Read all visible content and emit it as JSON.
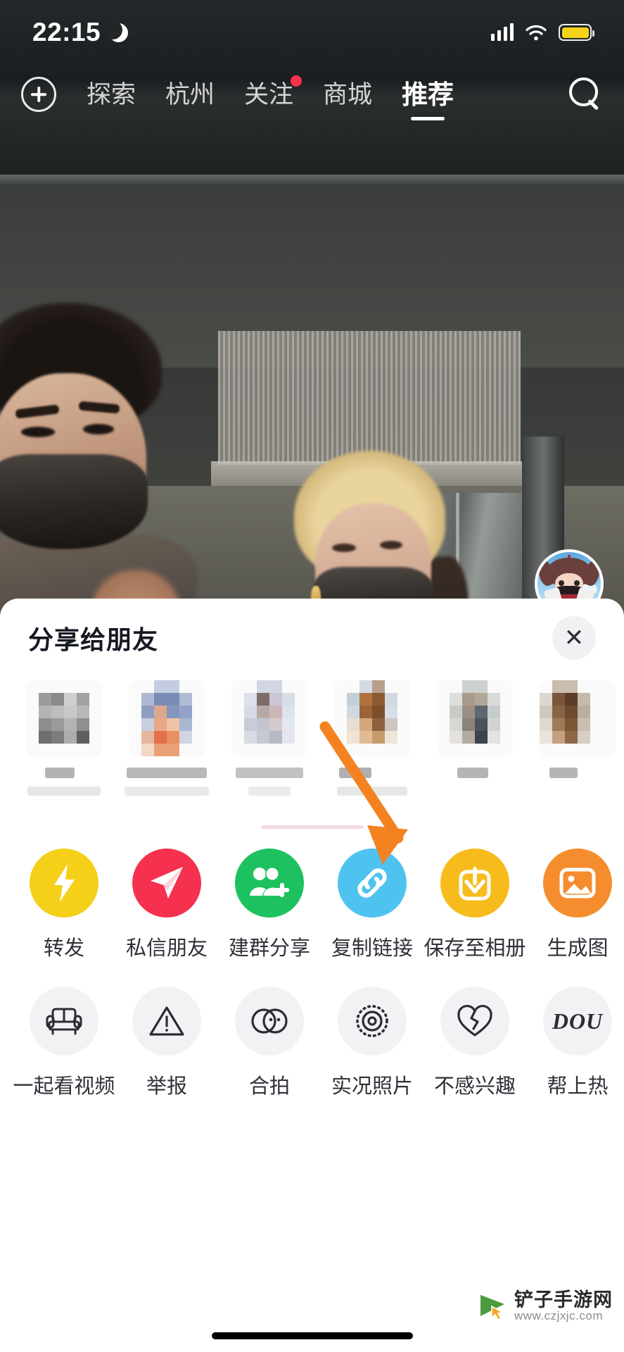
{
  "status_bar": {
    "time": "22:15",
    "moon_icon": "crescent-moon-icon",
    "signal_icon": "cellular-signal-icon",
    "wifi_icon": "wifi-icon",
    "battery_icon": "battery-icon",
    "battery_color": "#f5d318"
  },
  "top_nav": {
    "add_icon": "plus-circle-icon",
    "search_icon": "search-icon",
    "tabs": [
      {
        "label": "探索",
        "active": false,
        "badge": false
      },
      {
        "label": "杭州",
        "active": false,
        "badge": false
      },
      {
        "label": "关注",
        "active": false,
        "badge": true
      },
      {
        "label": "商城",
        "active": false,
        "badge": false
      },
      {
        "label": "推荐",
        "active": true,
        "badge": false
      }
    ],
    "badge_color": "#f6334e"
  },
  "right_rail": {
    "avatar_name": "avatar",
    "follow_label": "+",
    "follow_color": "#fa2c55",
    "like_icon": "heart-icon"
  },
  "share_sheet": {
    "title": "分享给朋友",
    "close_label": "✕",
    "friends": [
      {
        "name": "",
        "censored": true
      },
      {
        "name": "",
        "censored": true
      },
      {
        "name": "",
        "censored": true
      },
      {
        "name": "",
        "censored": true
      },
      {
        "name": "",
        "censored": true
      },
      {
        "name": "",
        "censored": true
      }
    ],
    "actions_row1": [
      {
        "label": "转发",
        "icon": "lightning-bolt-icon",
        "color": "#f5cf18"
      },
      {
        "label": "私信朋友",
        "icon": "paper-plane-icon",
        "color": "#f5314f"
      },
      {
        "label": "建群分享",
        "icon": "add-group-icon",
        "color": "#1ec15f"
      },
      {
        "label": "复制链接",
        "icon": "link-icon",
        "color": "#4fc3ef"
      },
      {
        "label": "保存至相册",
        "icon": "download-icon",
        "color": "#f7bc1c"
      },
      {
        "label": "生成图",
        "icon": "image-icon",
        "color": "#f58d2e"
      }
    ],
    "actions_row2": [
      {
        "label": "一起看视频",
        "icon": "sofa-icon"
      },
      {
        "label": "举报",
        "icon": "warning-triangle-icon"
      },
      {
        "label": "合拍",
        "icon": "duet-circles-icon"
      },
      {
        "label": "实况照片",
        "icon": "live-photo-icon"
      },
      {
        "label": "不感兴趣",
        "icon": "broken-heart-icon"
      },
      {
        "label": "帮上热",
        "icon": "dou-text-icon",
        "icon_text": "DOU"
      }
    ]
  },
  "annotation": {
    "arrow_color": "#f58220",
    "points_to": "保存至相册"
  },
  "watermark": {
    "site_name": "铲子手游网",
    "url": "www.czjxjc.com",
    "icon": "play-cursor-icon"
  },
  "home_indicator": "home-indicator"
}
